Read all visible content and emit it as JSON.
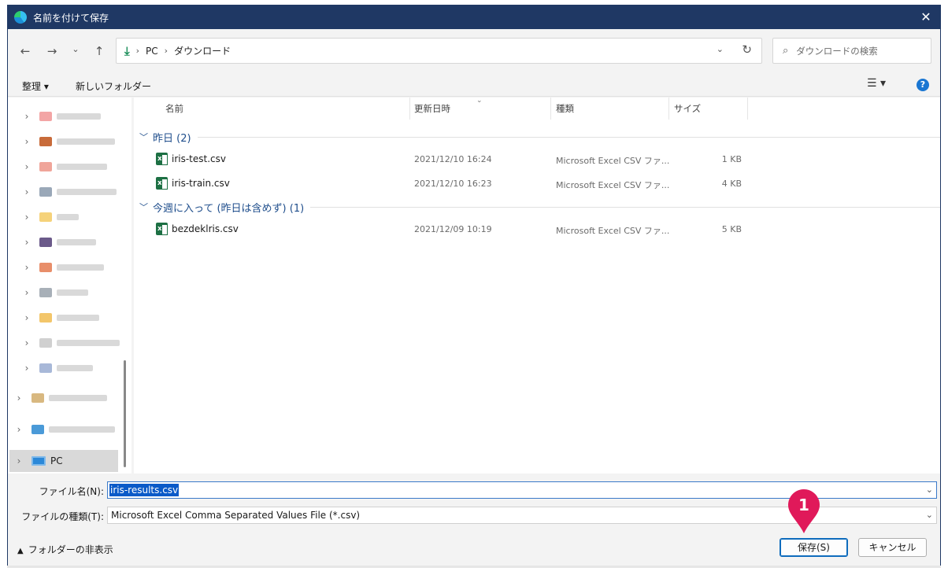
{
  "window": {
    "title": "名前を付けて保存",
    "close_glyph": "✕"
  },
  "nav": {
    "back_glyph": "←",
    "forward_glyph": "→",
    "history_glyph": "⌄",
    "up_glyph": "↑",
    "address": {
      "crumbs": [
        "PC",
        "ダウンロード"
      ],
      "separator": "›",
      "dropdown_glyph": "⌄",
      "refresh_glyph": "↻"
    },
    "search": {
      "placeholder": "ダウンロードの検索",
      "icon": "search-icon"
    }
  },
  "toolbar": {
    "organize_label": "整理 ▾",
    "new_folder_label": "新しいフォルダー",
    "view_glyph": "☰ ▾",
    "help_glyph": "?"
  },
  "sidebar": {
    "items": [
      {
        "label": "Onedrive",
        "blurred": true,
        "icon_color": "#f3a5a5"
      },
      {
        "label": "PowerBI",
        "blurred": true,
        "icon_color": "#c86b3a"
      },
      {
        "label": "Diagrams",
        "blurred": true,
        "icon_color": "#f0a59a"
      },
      {
        "label": "OneDrive Misc",
        "blurred": true,
        "icon_color": "#9aa8b8"
      },
      {
        "label": "2021",
        "blurred": true,
        "icon_color": "#f5d27a"
      },
      {
        "label": "Projects",
        "blurred": true,
        "icon_color": "#6b5a8a"
      },
      {
        "label": "Downloads",
        "blurred": true,
        "icon_color": "#e88e6a"
      },
      {
        "label": "Pictures",
        "blurred": true,
        "icon_color": "#a8b0b8"
      },
      {
        "label": "Misc",
        "blurred": true,
        "icon_color": "#f3c66a"
      },
      {
        "label": "Other",
        "blurred": true,
        "icon_color": "#d0d0d0"
      },
      {
        "label": "User",
        "blurred": true,
        "icon_color": "#a8b8d8"
      },
      {
        "label": "Network",
        "blurred": true,
        "icon_color": "#d8b880"
      },
      {
        "label": "Remote",
        "blurred": true,
        "icon_color": "#4a9ad8"
      }
    ],
    "pc_label": "PC"
  },
  "columns": {
    "name": "名前",
    "date": "更新日時",
    "type": "種類",
    "size": "サイズ",
    "sort_glyph": "⌄"
  },
  "groups": [
    {
      "label": "昨日 (2)",
      "files": [
        {
          "name": "iris-test.csv",
          "date": "2021/12/10 16:24",
          "type": "Microsoft Excel CSV ファ...",
          "size": "1 KB"
        },
        {
          "name": "iris-train.csv",
          "date": "2021/12/10 16:23",
          "type": "Microsoft Excel CSV ファ...",
          "size": "4 KB"
        }
      ]
    },
    {
      "label": "今週に入って (昨日は含めず) (1)",
      "files": [
        {
          "name": "bezdeklris.csv",
          "date": "2021/12/09 10:19",
          "type": "Microsoft Excel CSV ファ...",
          "size": "5 KB"
        }
      ]
    }
  ],
  "footer": {
    "filename_label": "ファイル名(N):",
    "filename_value": "iris-results.csv",
    "filetype_label": "ファイルの種類(T):",
    "filetype_value": "Microsoft Excel Comma Separated Values File (*.csv)",
    "hide_folders_label": "フォルダーの非表示",
    "save_label": "保存(S)",
    "cancel_label": "キャンセル"
  },
  "annotation": {
    "marker_number": "1",
    "marker_color": "#e0195a"
  }
}
